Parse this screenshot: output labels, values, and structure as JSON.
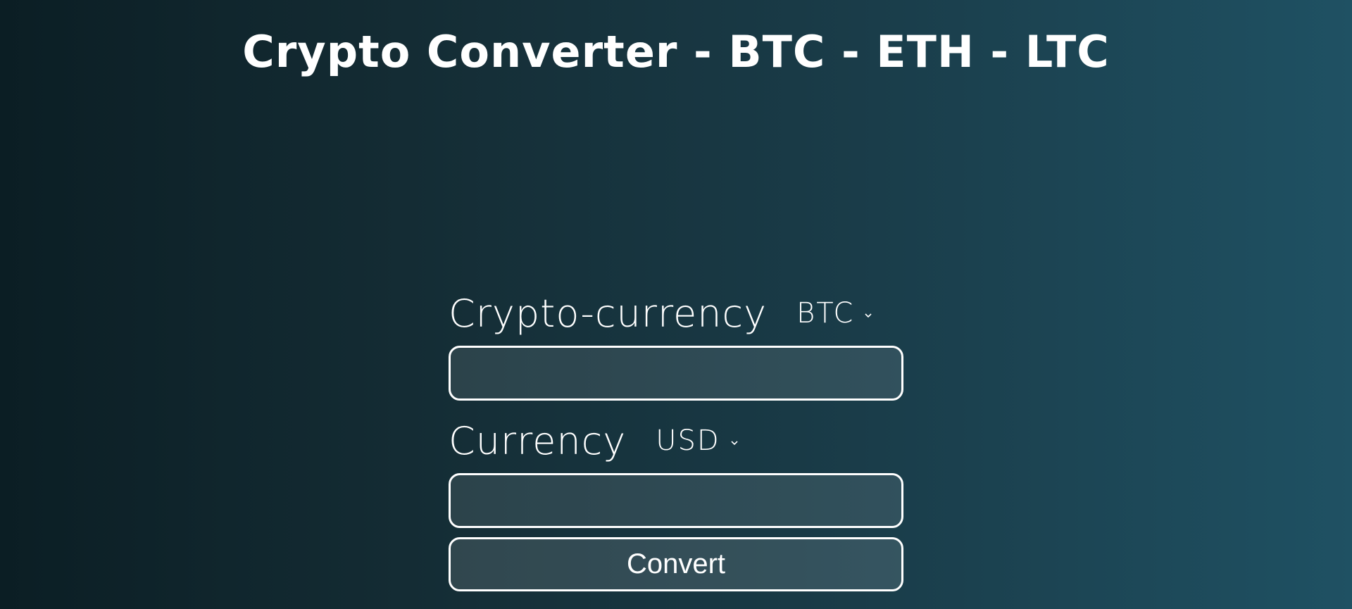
{
  "header": {
    "title": "Crypto Converter - BTC - ETH - LTC"
  },
  "form": {
    "crypto": {
      "label": "Crypto-currency",
      "selected": "BTC",
      "amount_value": ""
    },
    "fiat": {
      "label": "Currency",
      "selected": "USD",
      "amount_value": ""
    },
    "convert_label": "Convert"
  },
  "colors": {
    "text": "#ffffff",
    "bg_left": "#0b1e24",
    "bg_right": "#1f5163"
  },
  "icons": {
    "select_chevron": "chevron-down-icon"
  }
}
